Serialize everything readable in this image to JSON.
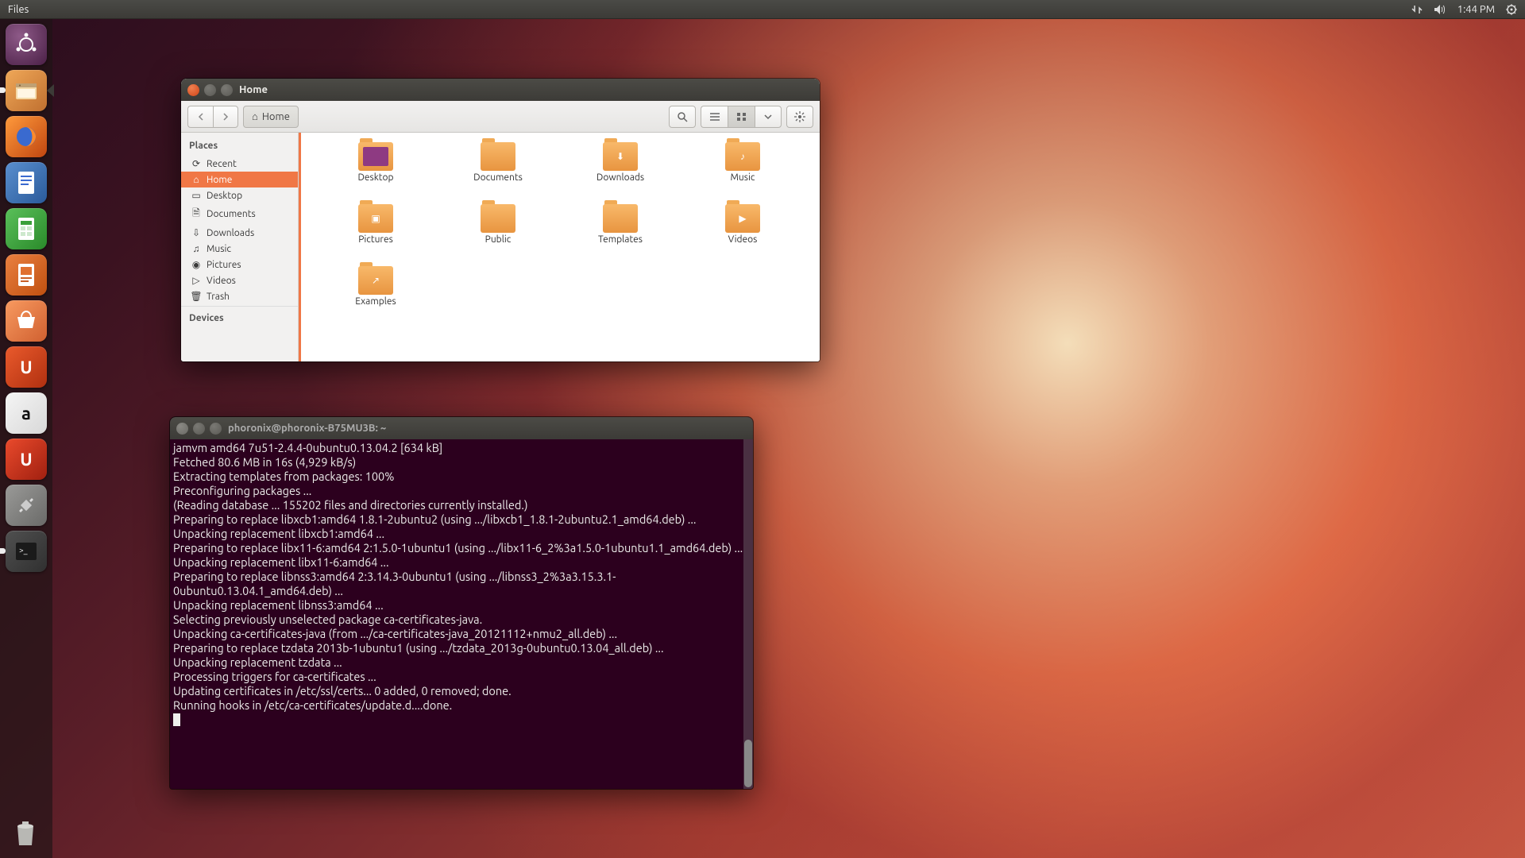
{
  "top_bar": {
    "app_name": "Files",
    "time": "1:44 PM"
  },
  "launcher": {
    "items": [
      {
        "name": "dash",
        "label": "Dash"
      },
      {
        "name": "files",
        "label": "Files",
        "running": true,
        "focused": true
      },
      {
        "name": "firefox",
        "label": "Firefox"
      },
      {
        "name": "writer",
        "label": "LibreOffice Writer"
      },
      {
        "name": "calc",
        "label": "LibreOffice Calc"
      },
      {
        "name": "impress",
        "label": "LibreOffice Impress"
      },
      {
        "name": "software",
        "label": "Ubuntu Software Center"
      },
      {
        "name": "ubuntuone",
        "label": "Ubuntu One"
      },
      {
        "name": "amazon",
        "label": "Amazon"
      },
      {
        "name": "updates",
        "label": "Software Updater"
      },
      {
        "name": "settings",
        "label": "System Settings"
      },
      {
        "name": "terminal",
        "label": "Terminal",
        "running": true
      }
    ],
    "trash": "Trash"
  },
  "nautilus": {
    "title": "Home",
    "breadcrumb": "Home",
    "sidebar": {
      "places_heading": "Places",
      "devices_heading": "Devices",
      "items": [
        {
          "icon": "⟳",
          "label": "Recent"
        },
        {
          "icon": "⌂",
          "label": "Home",
          "active": true
        },
        {
          "icon": "▭",
          "label": "Desktop"
        },
        {
          "icon": "🗎",
          "label": "Documents"
        },
        {
          "icon": "⇩",
          "label": "Downloads"
        },
        {
          "icon": "♫",
          "label": "Music"
        },
        {
          "icon": "◉",
          "label": "Pictures"
        },
        {
          "icon": "▷",
          "label": "Videos"
        },
        {
          "icon": "🗑",
          "label": "Trash"
        }
      ]
    },
    "files": [
      {
        "label": "Desktop",
        "badge_bg": "#8e3a82"
      },
      {
        "label": "Documents",
        "badge_bg": ""
      },
      {
        "label": "Downloads",
        "badge_bg": "",
        "glyph": "⬇"
      },
      {
        "label": "Music",
        "badge_bg": "",
        "glyph": "♪"
      },
      {
        "label": "Pictures",
        "badge_bg": "",
        "glyph": "▣"
      },
      {
        "label": "Public",
        "badge_bg": ""
      },
      {
        "label": "Templates",
        "badge_bg": ""
      },
      {
        "label": "Videos",
        "badge_bg": "",
        "glyph": "▶"
      },
      {
        "label": "Examples",
        "badge_bg": "",
        "glyph": "↗"
      }
    ]
  },
  "terminal": {
    "title": "phoronix@phoronix-B75MU3B: ~",
    "lines": [
      "jamvm amd64 7u51-2.4.4-0ubuntu0.13.04.2 [634 kB]",
      "Fetched 80.6 MB in 16s (4,929 kB/s)",
      "Extracting templates from packages: 100%",
      "Preconfiguring packages ...",
      "(Reading database ... 155202 files and directories currently installed.)",
      "Preparing to replace libxcb1:amd64 1.8.1-2ubuntu2 (using .../libxcb1_1.8.1-2ubuntu2.1_amd64.deb) ...",
      "Unpacking replacement libxcb1:amd64 ...",
      "Preparing to replace libx11-6:amd64 2:1.5.0-1ubuntu1 (using .../libx11-6_2%3a1.5.0-1ubuntu1.1_amd64.deb) ...",
      "Unpacking replacement libx11-6:amd64 ...",
      "Preparing to replace libnss3:amd64 2:3.14.3-0ubuntu1 (using .../libnss3_2%3a3.15.3.1-0ubuntu0.13.04.1_amd64.deb) ...",
      "Unpacking replacement libnss3:amd64 ...",
      "Selecting previously unselected package ca-certificates-java.",
      "Unpacking ca-certificates-java (from .../ca-certificates-java_20121112+nmu2_all.deb) ...",
      "Preparing to replace tzdata 2013b-1ubuntu1 (using .../tzdata_2013g-0ubuntu0.13.04_all.deb) ...",
      "Unpacking replacement tzdata ...",
      "Processing triggers for ca-certificates ...",
      "Updating certificates in /etc/ssl/certs... 0 added, 0 removed; done.",
      "Running hooks in /etc/ca-certificates/update.d....done."
    ]
  }
}
